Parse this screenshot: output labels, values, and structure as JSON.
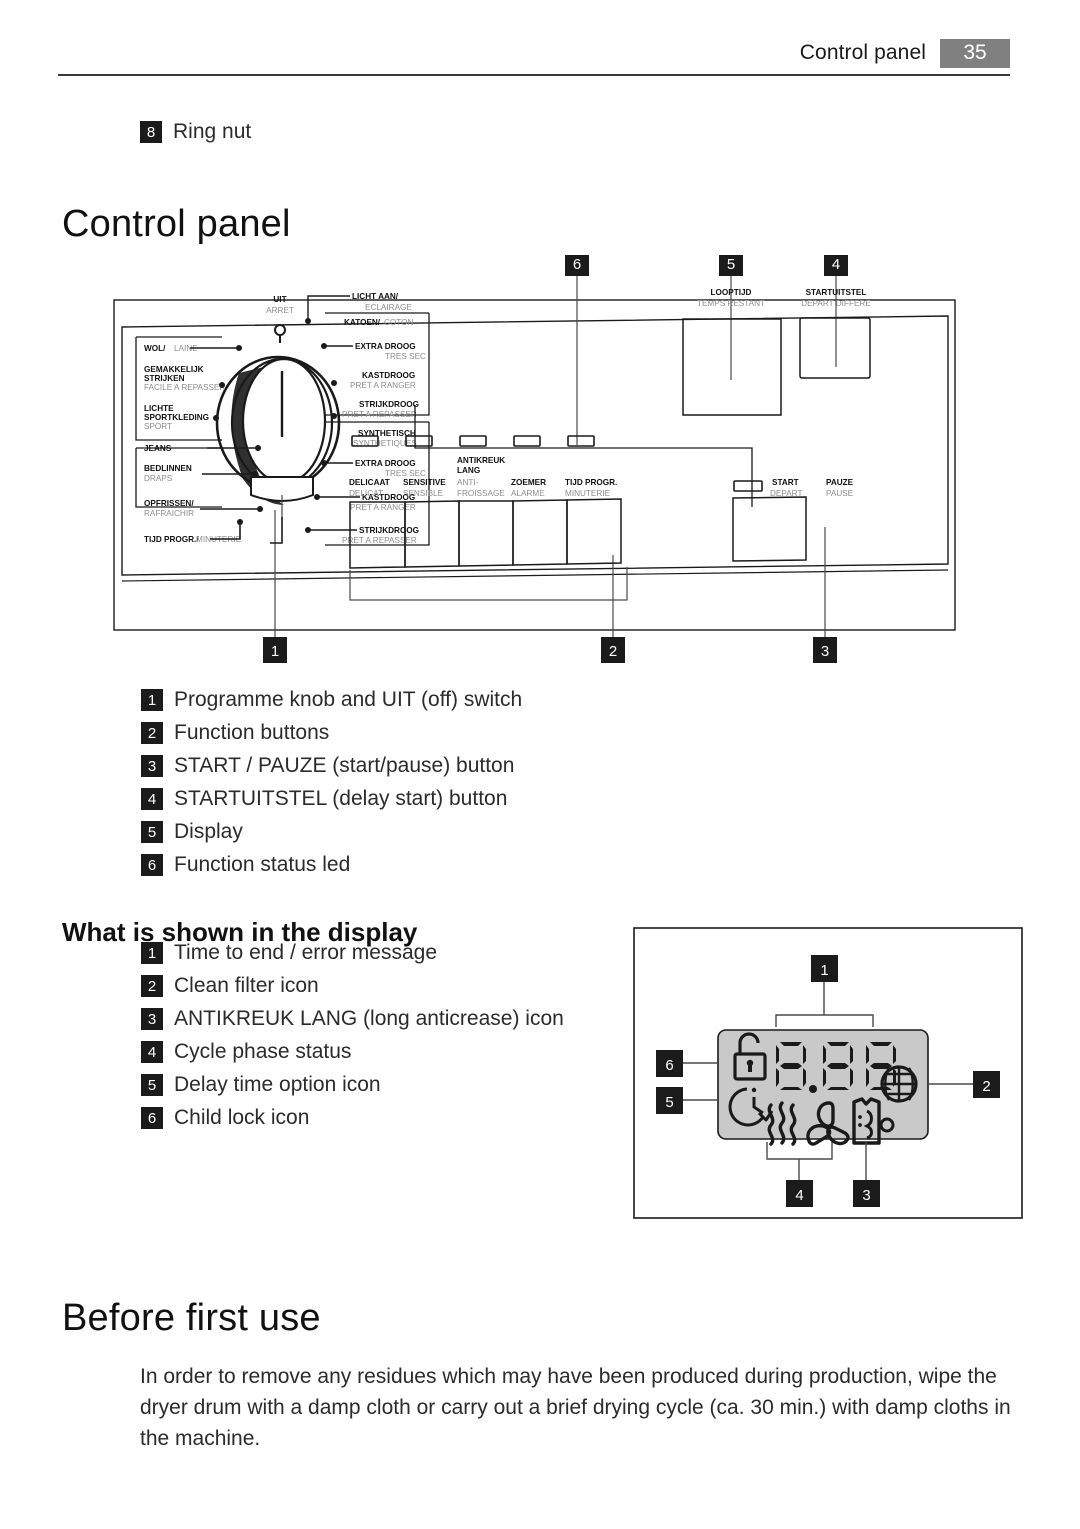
{
  "header": {
    "title": "Control panel",
    "page_number": "35"
  },
  "ring_nut_item": {
    "number": "8",
    "label": "Ring nut"
  },
  "headings": {
    "control_panel": "Control panel",
    "what_is_shown": "What is shown in the display",
    "before_first_use": "Before first use"
  },
  "panel_legend": [
    {
      "number": "1",
      "text": "Programme knob and UIT (off) switch"
    },
    {
      "number": "2",
      "text": "Function buttons"
    },
    {
      "number": "3",
      "text": "START / PAUZE (start/pause) button"
    },
    {
      "number": "4",
      "text": "STARTUITSTEL (delay start) button"
    },
    {
      "number": "5",
      "text": "Display"
    },
    {
      "number": "6",
      "text": "Function status led"
    }
  ],
  "display_legend": [
    {
      "number": "1",
      "text": "Time to end / error message"
    },
    {
      "number": "2",
      "text": "Clean filter icon"
    },
    {
      "number": "3",
      "text": "ANTIKREUK LANG (long anticrease) icon"
    },
    {
      "number": "4",
      "text": "Cycle phase status"
    },
    {
      "number": "5",
      "text": "Delay time option icon"
    },
    {
      "number": "6",
      "text": "Child lock icon"
    }
  ],
  "before_first_use_text": "In order to remove any residues which may have been produced during production, wipe the dryer drum with a damp cloth or carry out a brief drying cycle (ca. 30 min.) with damp cloths in the machine.",
  "panel_diagram": {
    "callouts_top": [
      "6",
      "5",
      "4"
    ],
    "callouts_bottom": [
      "1",
      "2",
      "3"
    ],
    "knob": {
      "off_nl": "UIT",
      "off_fr": "ARRET",
      "light_nl": "LICHT AAN/",
      "light_fr": "ECLAIRAGE"
    },
    "left_programmes": [
      {
        "nl": "WOL/",
        "fr": "LAINE"
      },
      {
        "nl": "GEMAKKELIJK",
        "nl2": "STRIJKEN",
        "fr": "FACILE A REPASSER"
      },
      {
        "nl": "LICHTE",
        "nl2": "SPORTKLEDING",
        "fr": "SPORT"
      },
      {
        "nl": "JEANS",
        "fr": ""
      },
      {
        "nl": "BEDLINNEN",
        "fr": "DRAPS"
      },
      {
        "nl": "OPFRISSEN/",
        "fr": "RAFRAICHIR"
      },
      {
        "nl": "TIJD PROGR./",
        "fr": "MINUTERIE"
      }
    ],
    "right_group_cotton": {
      "header_nl": "KATOEN/",
      "header_fr": "COTON",
      "items": [
        {
          "nl": "EXTRA DROOG",
          "fr": "TRES SEC"
        },
        {
          "nl": "KASTDROOG",
          "fr": "PRET A RANGER"
        },
        {
          "nl": "STRIJKDROOG",
          "fr": "PRET A REPASSER"
        }
      ]
    },
    "right_group_synthetic": {
      "header_nl": "SYNTHETISCH",
      "header_fr": "SYNTHETIQUES",
      "items": [
        {
          "nl": "EXTRA DROOG",
          "fr": "TRES SEC"
        },
        {
          "nl": "KASTDROOG",
          "fr": "PRET A RANGER"
        },
        {
          "nl": "STRIJKDROOG",
          "fr": "PRET A REPASSER"
        }
      ]
    },
    "display_label": {
      "nl": "LOOPTIJD",
      "fr": "TEMPS RESTANT"
    },
    "delay_label": {
      "nl": "STARTUITSTEL",
      "fr": "DEPART DIFFERE"
    },
    "function_buttons": [
      {
        "nl": "DELICAAT",
        "fr": "DELICAT"
      },
      {
        "nl": "SENSITIVE",
        "fr": "SENSIBLE"
      },
      {
        "nl": "ANTIKREUK",
        "nl2": "LANG",
        "fr": "ANTI-",
        "fr2": "FROISSAGE"
      },
      {
        "nl": "ZOEMER",
        "fr": "ALARME"
      },
      {
        "nl": "TIJD PROGR.",
        "fr": "MINUTERIE"
      }
    ],
    "start_button": {
      "nl": "START",
      "fr": "DEPART",
      "nl_b": "PAUZE",
      "fr_b": "PAUSE"
    }
  },
  "display_diagram": {
    "callout_top": "1",
    "callout_right": "2",
    "callout_bottom_left": "4",
    "callout_bottom_right": "3",
    "callout_left_upper": "6",
    "callout_left_lower": "5",
    "segment_value": "8.88",
    "icons": [
      "child-lock-icon",
      "delay-time-icon",
      "heat-waves-icon",
      "fan-icon",
      "anticrease-shirt-icon",
      "clean-filter-grid-icon"
    ],
    "lcd_background": "#c9c9c9"
  }
}
